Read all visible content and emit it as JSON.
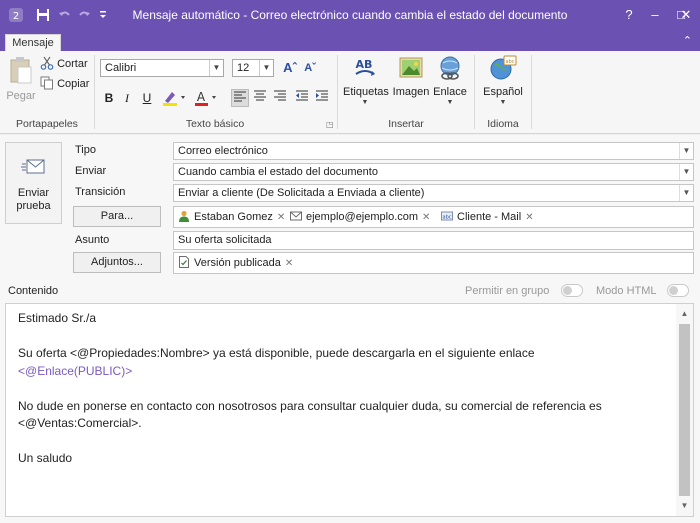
{
  "window": {
    "title": "Mensaje automático - Correo electrónico cuando cambia el estado del documento",
    "minimize": "–",
    "maximize": "□",
    "close": "✕",
    "help": "?"
  },
  "ribbon": {
    "tab": "Mensaje",
    "collapse": "⌃",
    "portapapeles": {
      "label": "Portapapeles",
      "pegar": "Pegar",
      "cortar": "Cortar",
      "copiar": "Copiar"
    },
    "texto_basico": {
      "label": "Texto básico",
      "font": "Calibri",
      "size": "12",
      "bold": "B",
      "italic": "I",
      "underline": "U"
    },
    "insertar": {
      "label": "Insertar",
      "etiquetas": "Etiquetas",
      "imagen": "Imagen",
      "enlace": "Enlace"
    },
    "idioma": {
      "label": "Idioma",
      "espanol": "Español"
    }
  },
  "form": {
    "send_test": {
      "line1": "Enviar",
      "line2": "prueba"
    },
    "tipo": {
      "label": "Tipo",
      "value": "Correo electrónico"
    },
    "enviar": {
      "label": "Enviar",
      "value": "Cuando cambia el estado del documento"
    },
    "transicion": {
      "label": "Transición",
      "value": "Enviar a cliente (De Solicitada a Enviada a cliente)"
    },
    "para": {
      "button": "Para...",
      "recipients": [
        "Estaban Gomez",
        "ejemplo@ejemplo.com",
        "Cliente - Mail"
      ]
    },
    "asunto": {
      "label": "Asunto",
      "value": "Su oferta solicitada"
    },
    "adjuntos": {
      "button": "Adjuntos...",
      "items": [
        "Versión publicada"
      ]
    },
    "contenido_label": "Contenido",
    "permitir_grupo": "Permitir en grupo",
    "modo_html": "Modo HTML"
  },
  "content": {
    "greeting": "Estimado Sr./a",
    "p1": "Su oferta <@Propiedades:Nombre>  ya está disponible, puede descargarla en el siguiente enlace",
    "p1_link": "<@Enlace(PUBLIC)>",
    "p2a": "No dude en ponerse en contacto con nosotrosos para consultar cualquier duda, su comercial de referencia es",
    "p2b": "<@Ventas:Comercial>.",
    "closing": "Un saludo"
  },
  "colors": {
    "titlebar": "#6b51b2",
    "link": "#7b59bf"
  }
}
